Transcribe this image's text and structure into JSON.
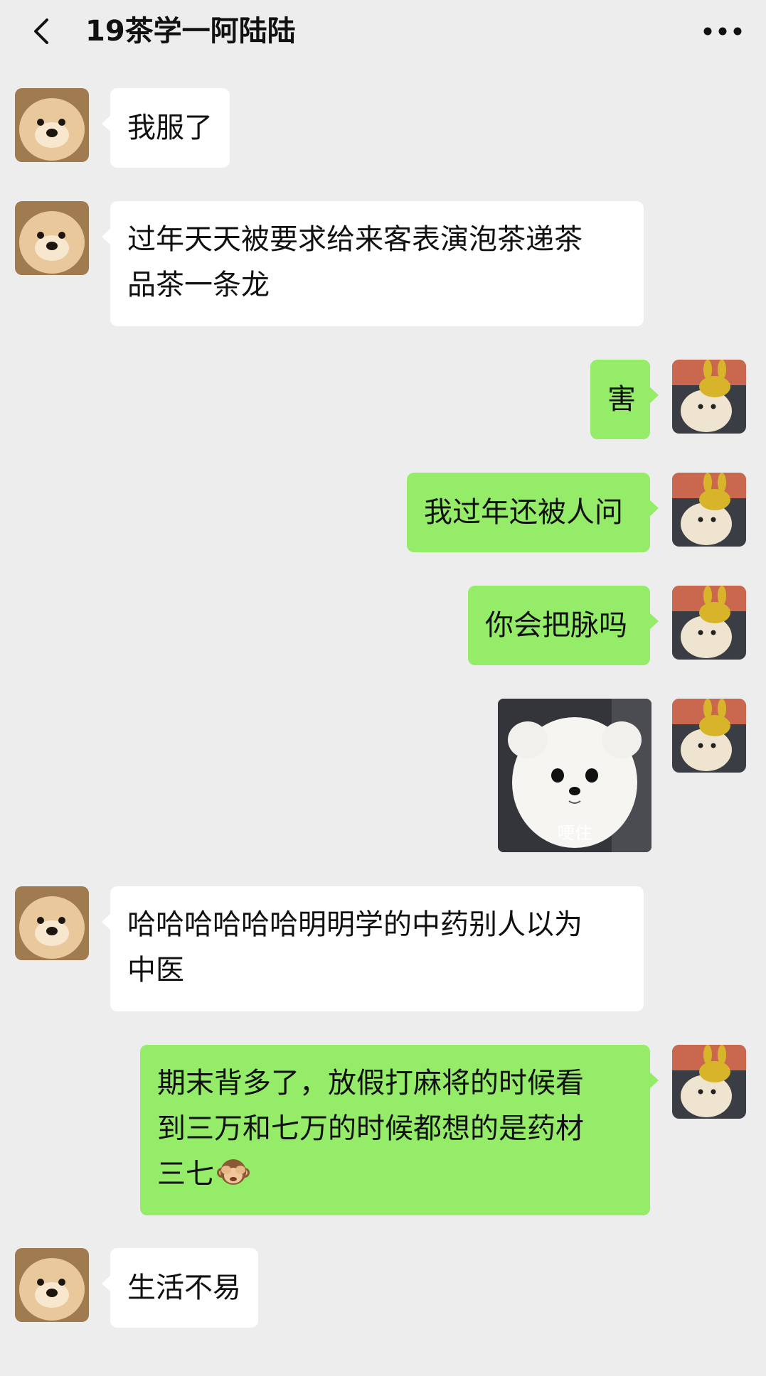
{
  "header": {
    "title": "19茶学一阿陆陆"
  },
  "messages": [
    {
      "from": "contact",
      "text": "我服了"
    },
    {
      "from": "contact",
      "text": "过年天天被要求给来客表演泡茶递茶\n品茶一条龙"
    },
    {
      "from": "me",
      "text": "害"
    },
    {
      "from": "me",
      "text": "我过年还被人问"
    },
    {
      "from": "me",
      "text": "你会把脉吗"
    },
    {
      "from": "me",
      "type": "sticker",
      "caption": "哽住",
      "icon": "white-puppy-sticker"
    },
    {
      "from": "contact",
      "text": "哈哈哈哈哈哈明明学的中药别人以为\n中医"
    },
    {
      "from": "me",
      "text": "期末背多了，放假打麻将的时候看\n到三万和七万的时候都想的是药材\n三七",
      "emoji": "see-no-evil-monkey-icon"
    },
    {
      "from": "contact",
      "text": "生活不易"
    }
  ],
  "colors": {
    "background": "#ededed",
    "incoming_bubble": "#ffffff",
    "outgoing_bubble": "#95ec69",
    "text": "#111111"
  },
  "icons": {
    "back": "chevron-left-icon",
    "more": "more-dots-icon",
    "contact_avatar": "puppy-avatar",
    "my_avatar": "cat-with-bunny-hat-avatar"
  }
}
